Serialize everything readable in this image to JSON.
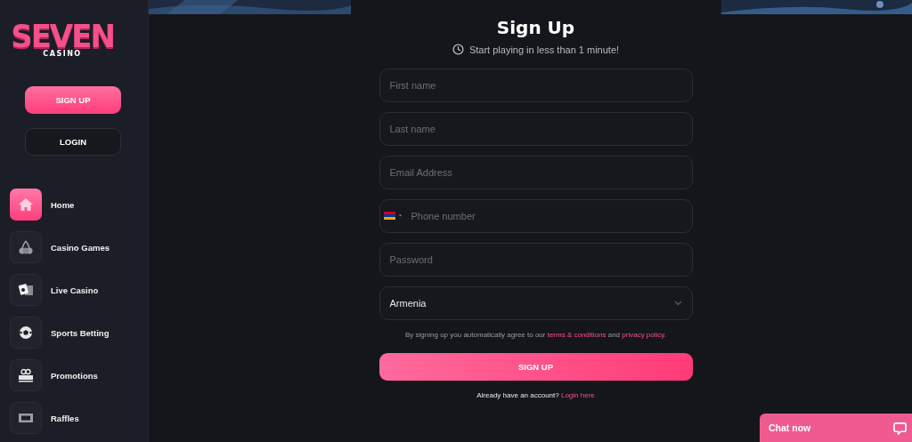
{
  "logo": {
    "title": "SEVEN",
    "subtitle": "CASINO"
  },
  "auth_buttons": [
    {
      "label": "SIGN UP",
      "kind": "primary"
    },
    {
      "label": "LOGIN",
      "kind": "secondary"
    }
  ],
  "sidebar": {
    "items": [
      {
        "label": "Home",
        "selected": true
      },
      {
        "label": "Casino Games",
        "selected": false
      },
      {
        "label": "Live Casino",
        "selected": false
      },
      {
        "label": "Sports Betting",
        "selected": false
      },
      {
        "label": "Promotions",
        "selected": false
      },
      {
        "label": "Raffles",
        "selected": false
      }
    ]
  },
  "form": {
    "title": "Sign Up",
    "subtitle": "Start playing in less than 1 minute!",
    "fields": [
      {
        "kind": "text",
        "placeholder": "First name"
      },
      {
        "kind": "text",
        "placeholder": "Last name"
      },
      {
        "kind": "email",
        "placeholder": "Email Address"
      },
      {
        "kind": "phone",
        "placeholder": "Phone number"
      },
      {
        "kind": "password",
        "placeholder": "Password"
      },
      {
        "kind": "select",
        "value": "Armenia"
      }
    ],
    "agreement": [
      {
        "kind": "text",
        "text": "By signing up you automatically agree to our "
      },
      {
        "kind": "link",
        "text": "terms & conditions"
      },
      {
        "kind": "text",
        "text": " and "
      },
      {
        "kind": "link",
        "text": "privacy policy"
      },
      {
        "kind": "text",
        "text": "."
      }
    ],
    "submit": "SIGN UP",
    "login_prompt": [
      {
        "kind": "text",
        "text": "Already have an account? "
      },
      {
        "kind": "link",
        "text": "Login here"
      }
    ]
  },
  "chat": {
    "label": "Chat now"
  }
}
